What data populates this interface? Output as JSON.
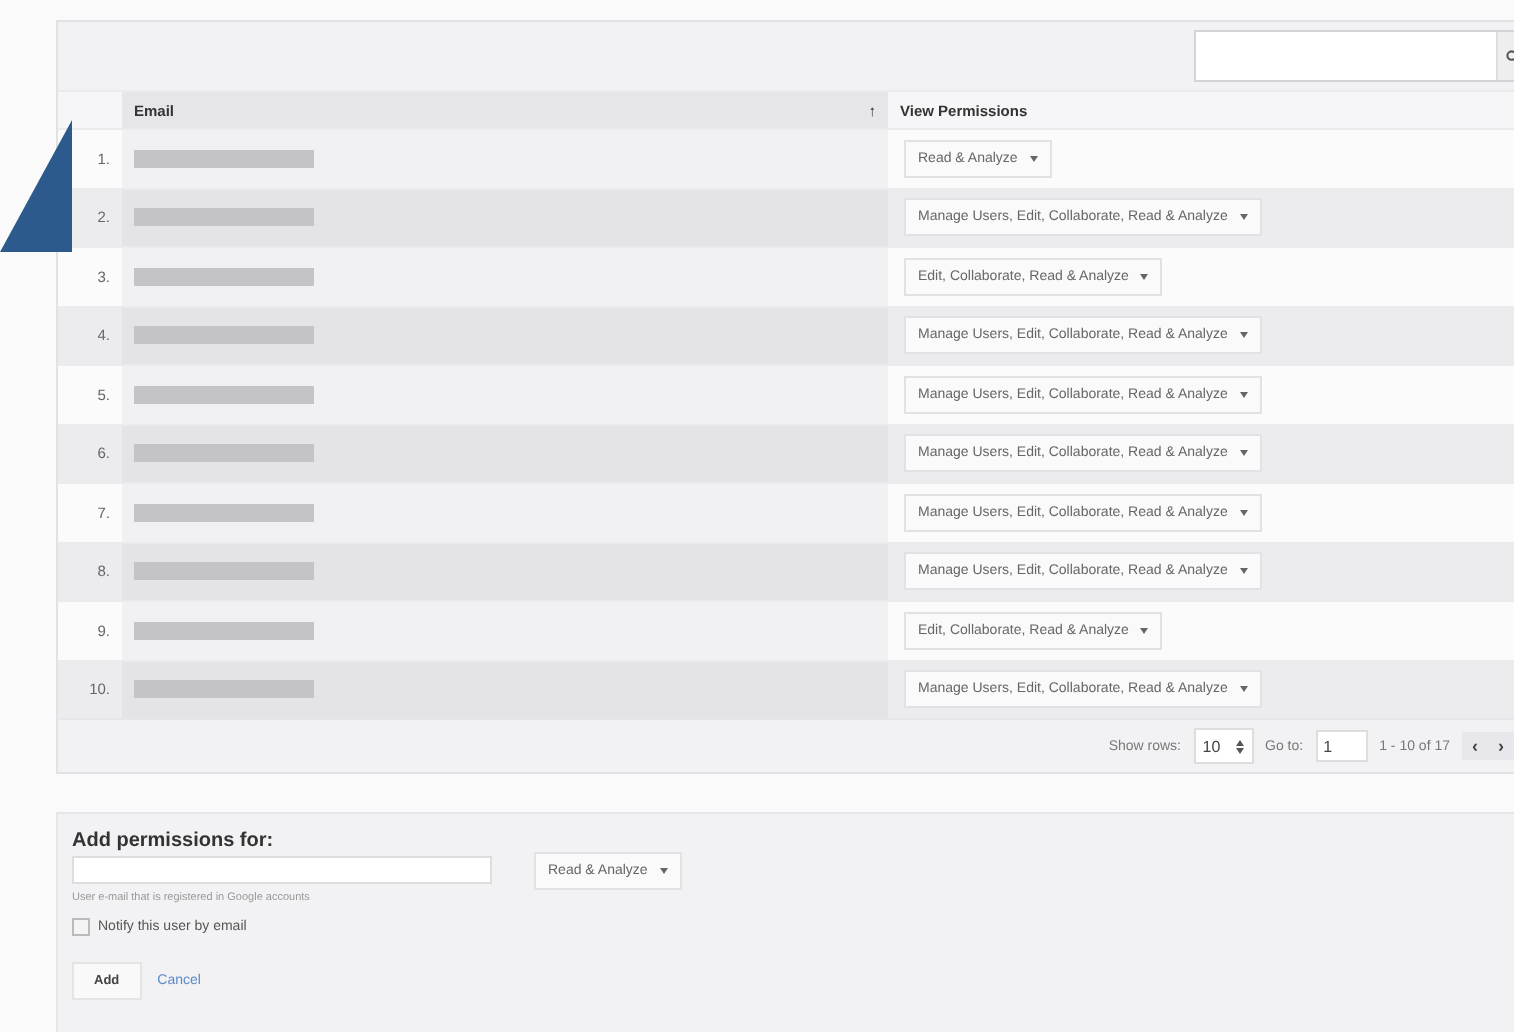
{
  "table": {
    "columns": [
      {
        "label": "Email",
        "sort_indicator": "↑"
      },
      {
        "label": "View Permissions"
      }
    ],
    "rows": [
      {
        "number": "1.",
        "permission": "Read & Analyze"
      },
      {
        "number": "2.",
        "permission": "Manage Users, Edit, Collaborate, Read & Analyze"
      },
      {
        "number": "3.",
        "permission": "Edit, Collaborate, Read & Analyze"
      },
      {
        "number": "4.",
        "permission": "Manage Users, Edit, Collaborate, Read & Analyze"
      },
      {
        "number": "5.",
        "permission": "Manage Users, Edit, Collaborate, Read & Analyze"
      },
      {
        "number": "6.",
        "permission": "Manage Users, Edit, Collaborate, Read & Analyze"
      },
      {
        "number": "7.",
        "permission": "Manage Users, Edit, Collaborate, Read & Analyze"
      },
      {
        "number": "8.",
        "permission": "Manage Users, Edit, Collaborate, Read & Analyze"
      },
      {
        "number": "9.",
        "permission": "Edit, Collaborate, Read & Analyze"
      },
      {
        "number": "10.",
        "permission": "Manage Users, Edit, Collaborate, Read & Analyze"
      }
    ]
  },
  "pagination": {
    "show_rows_label": "Show rows:",
    "show_rows_value": "10",
    "goto_label": "Go to:",
    "goto_value": "1",
    "range": "1 - 10 of 17",
    "prev": "‹",
    "next": "›"
  },
  "add_permissions": {
    "title": "Add permissions for:",
    "hint": "User e-mail that is registered in Google accounts",
    "permission": "Read & Analyze",
    "notify_label": "Notify this user by email",
    "notify_checked": false,
    "add_button": "Add",
    "cancel_link": "Cancel"
  }
}
